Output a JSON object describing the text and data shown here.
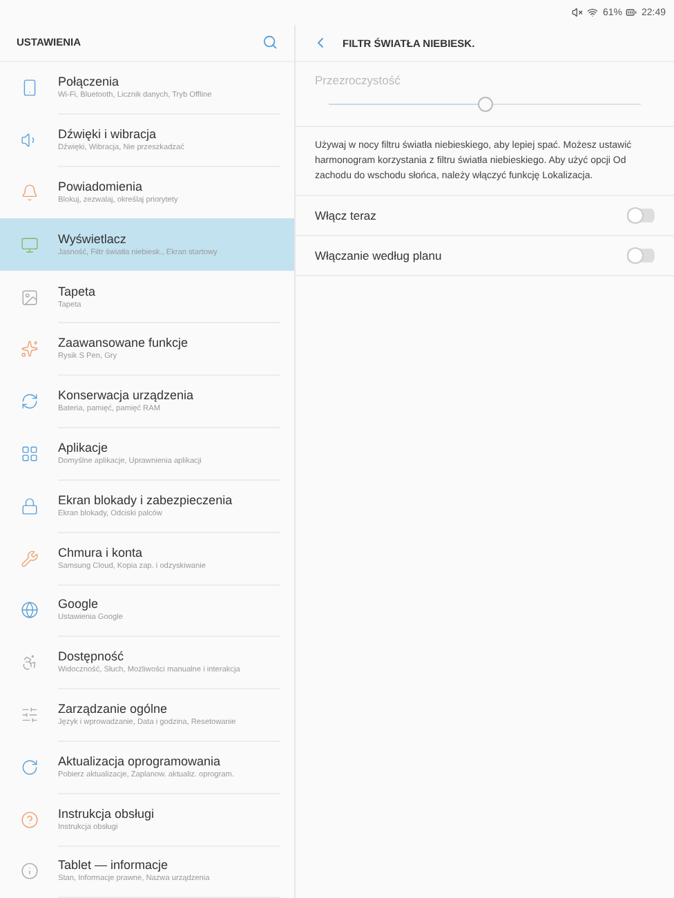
{
  "status_bar": {
    "battery": "61%",
    "time": "22:49"
  },
  "sidebar": {
    "title": "USTAWIENIA",
    "items": [
      {
        "title": "Połączenia",
        "subtitle": "Wi-Fi, Bluetooth, Licznik danych, Tryb Offline",
        "selected": false
      },
      {
        "title": "Dźwięki i wibracja",
        "subtitle": "Dźwięki, Wibracja, Nie przeszkadzać",
        "selected": false
      },
      {
        "title": "Powiadomienia",
        "subtitle": "Blokuj, zezwalaj, określaj priorytety",
        "selected": false
      },
      {
        "title": "Wyświetlacz",
        "subtitle": "Jasność, Filtr światła niebiesk., Ekran startowy",
        "selected": true
      },
      {
        "title": "Tapeta",
        "subtitle": "Tapeta",
        "selected": false
      },
      {
        "title": "Zaawansowane funkcje",
        "subtitle": "Rysik S Pen, Gry",
        "selected": false
      },
      {
        "title": "Konserwacja urządzenia",
        "subtitle": "Bateria, pamięć, pamięć RAM",
        "selected": false
      },
      {
        "title": "Aplikacje",
        "subtitle": "Domyślne aplikacje, Uprawnienia aplikacji",
        "selected": false
      },
      {
        "title": "Ekran blokady i zabezpieczenia",
        "subtitle": "Ekran blokady, Odciski palców",
        "selected": false
      },
      {
        "title": "Chmura i konta",
        "subtitle": "Samsung Cloud, Kopia zap. i odzyskiwanie",
        "selected": false
      },
      {
        "title": "Google",
        "subtitle": "Ustawienia Google",
        "selected": false
      },
      {
        "title": "Dostępność",
        "subtitle": "Widoczność, Słuch, Możliwości manualne i interakcja",
        "selected": false
      },
      {
        "title": "Zarządzanie ogólne",
        "subtitle": "Język i wprowadzanie, Data i godzina, Resetowanie",
        "selected": false
      },
      {
        "title": "Aktualizacja oprogramowania",
        "subtitle": "Pobierz aktualizacje, Zaplanow. aktualiz. oprogram.",
        "selected": false
      },
      {
        "title": "Instrukcja obsługi",
        "subtitle": "Instrukcja obsługi",
        "selected": false
      },
      {
        "title": "Tablet — informacje",
        "subtitle": "Stan, Informacje prawne, Nazwa urządzenia",
        "selected": false
      }
    ]
  },
  "detail": {
    "title": "FILTR ŚWIATŁA NIEBIESK.",
    "slider": {
      "label": "Przezroczystość",
      "level": 0.5,
      "disabled": true
    },
    "description": "Używaj w nocy filtru światła niebieskiego, aby lepiej spać. Możesz ustawić harmonogram korzystania z filtru światła niebieskiego. Aby użyć opcji Od zachodu do wschodu słońca, należy włączyć funkcję Lokalizacja.",
    "toggles": [
      {
        "label": "Włącz teraz",
        "on": false
      },
      {
        "label": "Włączanie według planu",
        "on": false
      }
    ]
  }
}
